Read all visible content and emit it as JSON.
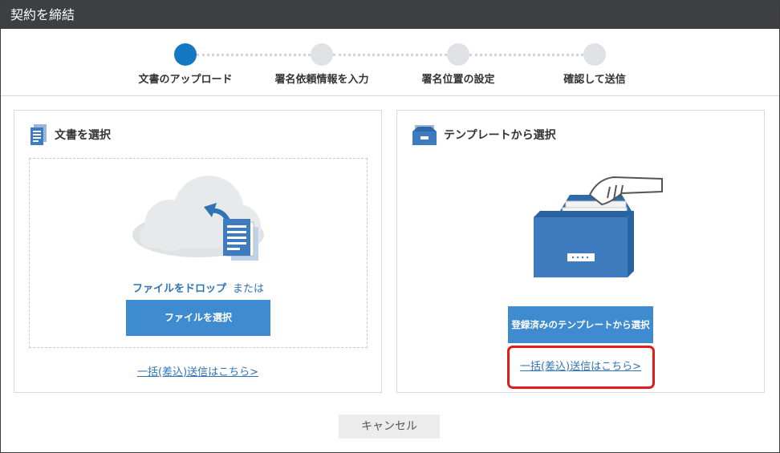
{
  "window": {
    "title": "契約を締結"
  },
  "stepper": {
    "steps": [
      {
        "label": "文書のアップロード",
        "active": true
      },
      {
        "label": "署名依頼情報を入力",
        "active": false
      },
      {
        "label": "署名位置の設定",
        "active": false
      },
      {
        "label": "確認して送信",
        "active": false
      }
    ]
  },
  "upload_panel": {
    "title": "文書を選択",
    "icon": "document-icon",
    "drop_text": "ファイルをドロップ",
    "or_text": "または",
    "select_button": "ファイルを選択",
    "bulk_link": "一括(差込)送信はこちら>"
  },
  "template_panel": {
    "title": "テンプレートから選択",
    "icon": "file-box-icon",
    "select_button": "登録済みのテンプレートから選択",
    "bulk_link": "一括(差込)送信はこちら>"
  },
  "footer": {
    "cancel_label": "キャンセル"
  },
  "colors": {
    "accent": "#3e8bd0",
    "active_step": "#1478c2",
    "highlight": "#e21a1a",
    "title_bar": "#3d3f43"
  }
}
